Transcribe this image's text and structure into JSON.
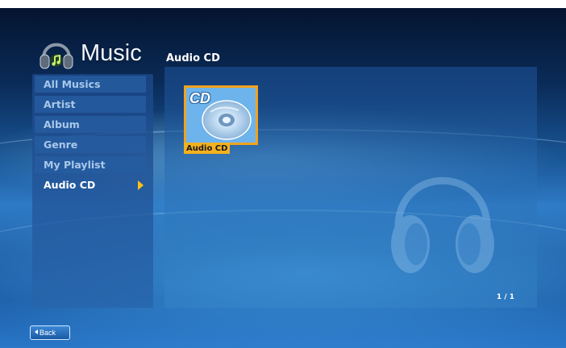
{
  "app": {
    "title": "Music",
    "logo_icon": "headphones-icon"
  },
  "header": {
    "section_title": "Audio CD"
  },
  "sidebar": {
    "items": [
      {
        "label": "All Musics",
        "active": false
      },
      {
        "label": "Artist",
        "active": false
      },
      {
        "label": "Album",
        "active": false
      },
      {
        "label": "Genre",
        "active": false
      },
      {
        "label": "My Playlist",
        "active": false
      },
      {
        "label": "Audio CD",
        "active": true
      }
    ],
    "active_arrow_color": "#ffc21a"
  },
  "content": {
    "tiles": [
      {
        "icon": "cd-disc-icon",
        "badge": "CD",
        "label": "Audio CD",
        "selected": true
      }
    ],
    "selection_color": "#f2a31f",
    "pager": "1 / 1"
  },
  "footer": {
    "back_label": "Back",
    "back_icon": "triangle-left-icon"
  },
  "colors": {
    "accent": "#f2b11f",
    "background_top": "#04142f",
    "background_mid": "#2f7bc6"
  }
}
